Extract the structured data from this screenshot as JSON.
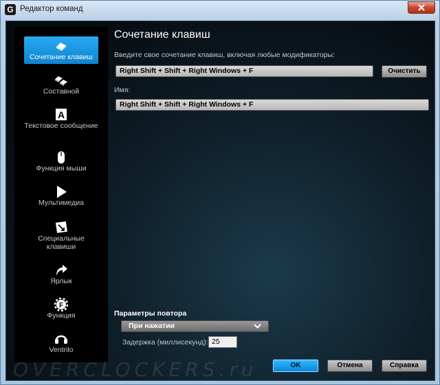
{
  "window": {
    "title": "Редактор команд",
    "app_icon": "G"
  },
  "sidebar": {
    "items": [
      {
        "label": "Сочетание клавиш",
        "icon": "key-icon",
        "active": true
      },
      {
        "label": "Составной",
        "icon": "keys-combo-icon"
      },
      {
        "label": "Текстовое сообщение",
        "icon": "text-a-icon"
      },
      {
        "label": "Функция мыши",
        "icon": "mouse-icon"
      },
      {
        "label": "Мультимедиа",
        "icon": "play-icon"
      },
      {
        "label": "Специальные клавиши",
        "icon": "special-key-icon"
      },
      {
        "label": "Ярлык",
        "icon": "shortcut-arrow-icon"
      },
      {
        "label": "Функция",
        "icon": "function-gear-icon"
      },
      {
        "label": "Ventrilo",
        "icon": "headset-icon"
      }
    ]
  },
  "main": {
    "title": "Сочетание клавиш",
    "prompt": "Введите свое сочетание клавиш, включая любые модификаторы:",
    "combo_value": "Right Shift + Shift + Right Windows + F",
    "clear_label": "Очистить",
    "name_label": "Имя:",
    "name_value": "Right Shift + Shift + Right Windows + F"
  },
  "repeat": {
    "label": "Параметры повтора",
    "mode": "При нажатии",
    "delay_label": "Задержка (миллисекунд):",
    "delay_value": "25"
  },
  "footer": {
    "ok": "OK",
    "cancel": "Отмена",
    "help": "Справка"
  },
  "watermark": "OVERCLOCKERS.ru",
  "colors": {
    "accent": "#1a9be6",
    "background": "#0b1820",
    "sidebar": "#000000"
  }
}
